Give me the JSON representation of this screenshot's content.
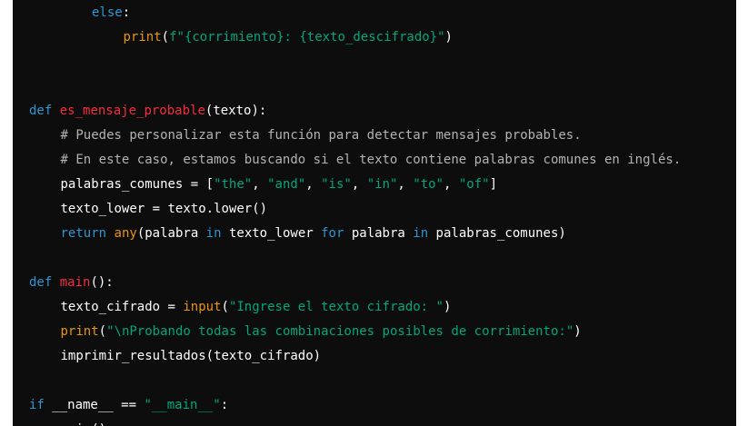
{
  "colors": {
    "background": "#0d0d0d",
    "page": "#ffffff",
    "keyword": "#2e95d3",
    "function_name": "#f22c3d",
    "string": "#00a67d",
    "comment": "#b3b3b3",
    "builtin": "#e9950c",
    "plain": "#ffffff"
  },
  "code": {
    "lines": [
      {
        "indent": 2,
        "tokens": [
          {
            "t": "kw",
            "text": "else"
          },
          {
            "t": "plain",
            "text": ":"
          }
        ]
      },
      {
        "indent": 3,
        "tokens": [
          {
            "t": "bi",
            "text": "print"
          },
          {
            "t": "plain",
            "text": "("
          },
          {
            "t": "str",
            "text": "f\"{corrimiento}: {texto_descifrado}\""
          },
          {
            "t": "plain",
            "text": ")"
          }
        ]
      },
      {
        "indent": 0,
        "tokens": []
      },
      {
        "indent": 0,
        "tokens": []
      },
      {
        "indent": 0,
        "tokens": [
          {
            "t": "kw",
            "text": "def"
          },
          {
            "t": "plain",
            "text": " "
          },
          {
            "t": "fn",
            "text": "es_mensaje_probable"
          },
          {
            "t": "plain",
            "text": "(texto):"
          }
        ]
      },
      {
        "indent": 1,
        "tokens": [
          {
            "t": "cmt",
            "text": "# Puedes personalizar esta función para detectar mensajes probables."
          }
        ]
      },
      {
        "indent": 1,
        "tokens": [
          {
            "t": "cmt",
            "text": "# En este caso, estamos buscando si el texto contiene palabras comunes en inglés."
          }
        ]
      },
      {
        "indent": 1,
        "tokens": [
          {
            "t": "plain",
            "text": "palabras_comunes = ["
          },
          {
            "t": "str",
            "text": "\"the\""
          },
          {
            "t": "plain",
            "text": ", "
          },
          {
            "t": "str",
            "text": "\"and\""
          },
          {
            "t": "plain",
            "text": ", "
          },
          {
            "t": "str",
            "text": "\"is\""
          },
          {
            "t": "plain",
            "text": ", "
          },
          {
            "t": "str",
            "text": "\"in\""
          },
          {
            "t": "plain",
            "text": ", "
          },
          {
            "t": "str",
            "text": "\"to\""
          },
          {
            "t": "plain",
            "text": ", "
          },
          {
            "t": "str",
            "text": "\"of\""
          },
          {
            "t": "plain",
            "text": "]"
          }
        ]
      },
      {
        "indent": 1,
        "tokens": [
          {
            "t": "plain",
            "text": "texto_lower = texto.lower()"
          }
        ]
      },
      {
        "indent": 1,
        "tokens": [
          {
            "t": "kw",
            "text": "return"
          },
          {
            "t": "plain",
            "text": " "
          },
          {
            "t": "bi",
            "text": "any"
          },
          {
            "t": "plain",
            "text": "(palabra "
          },
          {
            "t": "kw",
            "text": "in"
          },
          {
            "t": "plain",
            "text": " texto_lower "
          },
          {
            "t": "kw",
            "text": "for"
          },
          {
            "t": "plain",
            "text": " palabra "
          },
          {
            "t": "kw",
            "text": "in"
          },
          {
            "t": "plain",
            "text": " palabras_comunes)"
          }
        ]
      },
      {
        "indent": 0,
        "tokens": []
      },
      {
        "indent": 0,
        "tokens": [
          {
            "t": "kw",
            "text": "def"
          },
          {
            "t": "plain",
            "text": " "
          },
          {
            "t": "fn",
            "text": "main"
          },
          {
            "t": "plain",
            "text": "():"
          }
        ]
      },
      {
        "indent": 1,
        "tokens": [
          {
            "t": "plain",
            "text": "texto_cifrado = "
          },
          {
            "t": "bi",
            "text": "input"
          },
          {
            "t": "plain",
            "text": "("
          },
          {
            "t": "str",
            "text": "\"Ingrese el texto cifrado: \""
          },
          {
            "t": "plain",
            "text": ")"
          }
        ]
      },
      {
        "indent": 1,
        "tokens": [
          {
            "t": "bi",
            "text": "print"
          },
          {
            "t": "plain",
            "text": "("
          },
          {
            "t": "str",
            "text": "\"\\nProbando todas las combinaciones posibles de corrimiento:\""
          },
          {
            "t": "plain",
            "text": ")"
          }
        ]
      },
      {
        "indent": 1,
        "tokens": [
          {
            "t": "plain",
            "text": "imprimir_resultados(texto_cifrado)"
          }
        ]
      },
      {
        "indent": 0,
        "tokens": []
      },
      {
        "indent": 0,
        "tokens": [
          {
            "t": "kw",
            "text": "if"
          },
          {
            "t": "plain",
            "text": " __name__ == "
          },
          {
            "t": "str",
            "text": "\"__main__\""
          },
          {
            "t": "plain",
            "text": ":"
          }
        ]
      },
      {
        "indent": 1,
        "tokens": [
          {
            "t": "plain",
            "text": "main()"
          }
        ]
      }
    ]
  }
}
